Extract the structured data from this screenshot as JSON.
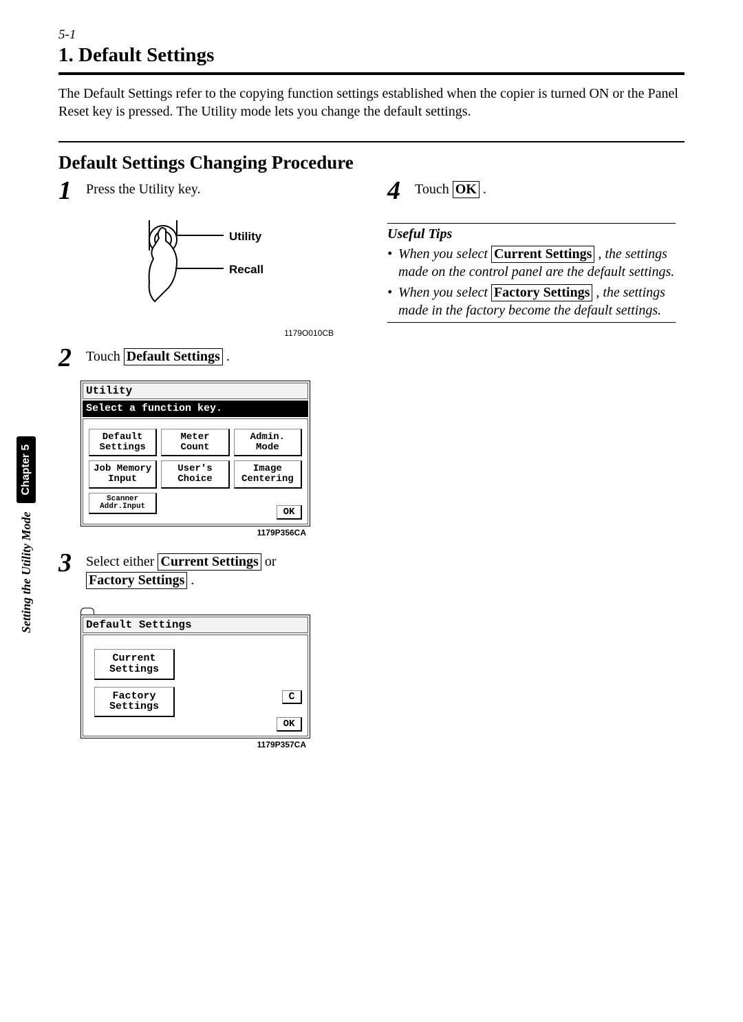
{
  "page": {
    "section_num": "5-1",
    "title": "1. Default Settings",
    "intro": "The Default Settings refer to the copying function settings established when the copier is turned ON or the Panel Reset key is pressed. The Utility mode lets you change the default settings.",
    "subhead": "Default Settings Changing Procedure"
  },
  "sidebar": {
    "mode": "Setting the Utility Mode",
    "chapter": "Chapter 5"
  },
  "steps": {
    "s1": {
      "num": "1",
      "text": "Press the Utility key."
    },
    "s2": {
      "num": "2",
      "pre": "Touch ",
      "box": "Default Settings",
      "post": " ."
    },
    "s3": {
      "num": "3",
      "pre": "Select either ",
      "box1": "Current Settings",
      "mid": " or ",
      "box2": "Factory Settings",
      "post": " ."
    },
    "s4": {
      "num": "4",
      "pre": "Touch ",
      "box": "OK",
      "post": " ."
    }
  },
  "illus": {
    "utility": "Utility",
    "recall": "Recall",
    "code": "1179O010CB"
  },
  "lcd1": {
    "title": "Utility",
    "msg": "Select a function key.",
    "buttons": [
      "Default\nSettings",
      "Meter\nCount",
      "Admin.\nMode",
      "Job Memory\nInput",
      "User's\nChoice",
      "Image\nCentering",
      "Scanner\nAddr.Input"
    ],
    "ok": "OK",
    "code": "1179P356CA"
  },
  "lcd2": {
    "title": "Default Settings",
    "b1": "Current\nSettings",
    "b2": "Factory\nSettings",
    "c": "C",
    "ok": "OK",
    "code": "1179P357CA"
  },
  "tips": {
    "head": "Useful Tips",
    "t1_pre": "When you select ",
    "t1_box": "Current Settings",
    "t1_post": " , the settings made on the control panel are the default settings.",
    "t2_pre": "When you select ",
    "t2_box": "Factory Settings",
    "t2_post": " , the settings made in the factory become the default settings."
  }
}
